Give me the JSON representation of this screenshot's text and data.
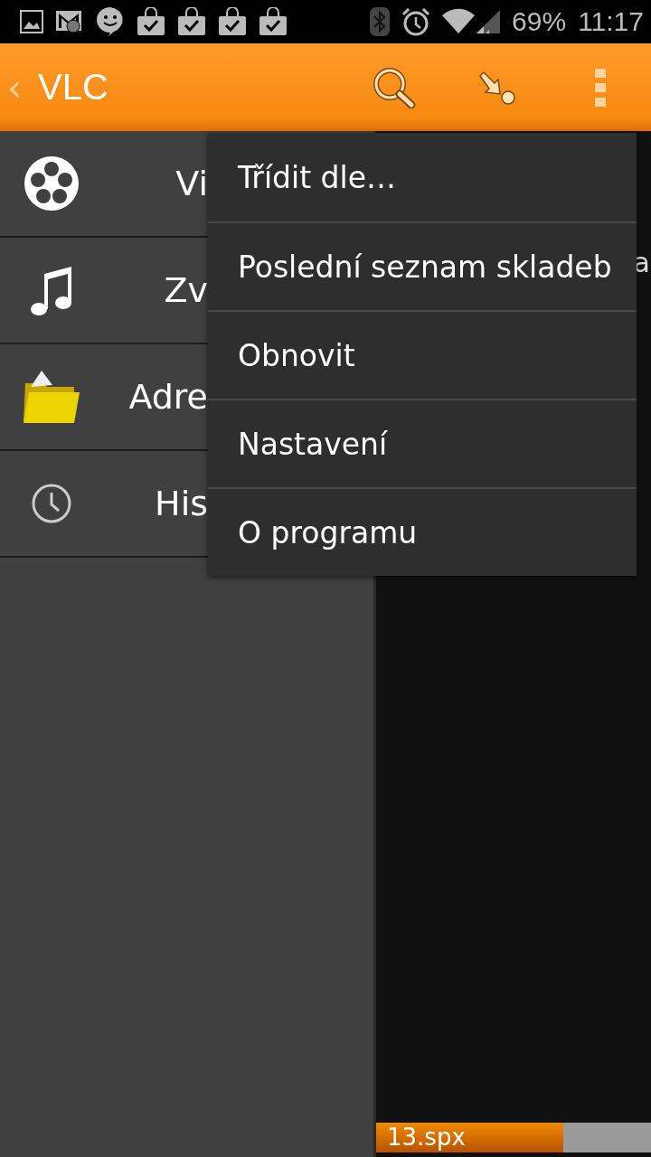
{
  "status_bar": {
    "battery": "69%",
    "time": "11:17"
  },
  "app_bar": {
    "back": "‹",
    "title": "VLC"
  },
  "sidebar": {
    "items": [
      {
        "kind": "video",
        "label": "Vi"
      },
      {
        "kind": "audio",
        "label": "Zv"
      },
      {
        "kind": "folder",
        "label": "Adre"
      },
      {
        "kind": "history",
        "label": "His"
      }
    ]
  },
  "main": {
    "column_1": "a"
  },
  "menu": {
    "items": [
      "Třídit dle…",
      "Poslední seznam skladeb",
      "Obnovit",
      "Nastavení",
      "O programu"
    ]
  },
  "mini_player": {
    "title": "13.spx",
    "level": 0.68
  }
}
